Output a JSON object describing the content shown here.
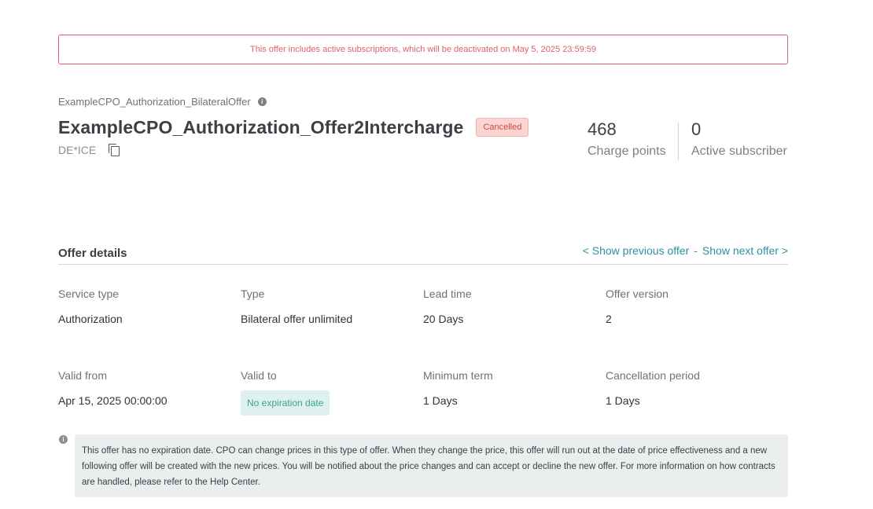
{
  "alert": {
    "message": "This offer includes active subscriptions, which will be deactivated on May 5, 2025 23:59:59"
  },
  "header": {
    "parent_offer": "ExampleCPO_Authorization_BilateralOffer",
    "title": "ExampleCPO_Authorization_Offer2Intercharge",
    "status": "Cancelled",
    "code": "DE*ICE"
  },
  "stats": [
    {
      "value": "468",
      "label": "Charge points"
    },
    {
      "value": "0",
      "label": "Active subscriber"
    }
  ],
  "details": {
    "section_title": "Offer details",
    "prev_link": "< Show previous offer",
    "separator": "-",
    "next_link": "Show next offer >",
    "fields": {
      "service_type": {
        "label": "Service type",
        "value": "Authorization"
      },
      "type": {
        "label": "Type",
        "value": "Bilateral offer unlimited"
      },
      "lead_time": {
        "label": "Lead time",
        "value": "20 Days"
      },
      "offer_version": {
        "label": "Offer version",
        "value": "2"
      },
      "valid_from": {
        "label": "Valid from",
        "value": "Apr 15, 2025 00:00:00"
      },
      "valid_to": {
        "label": "Valid to",
        "value": "No expiration date"
      },
      "minimum_term": {
        "label": "Minimum term",
        "value": "1 Days"
      },
      "cancellation_period": {
        "label": "Cancellation period",
        "value": "1 Days"
      }
    }
  },
  "note": {
    "text": "This offer has no expiration date. CPO can change prices in this type of offer. When they change the price, this offer will run out at the date of price effectiveness and a new following offer will be created with the new prices. You will be notified about the price changes and can accept or decline the new offer. For more information on how contracts are handled, please refer to the Help Center."
  },
  "icons": {
    "info": "info-icon",
    "copy": "copy-icon"
  },
  "colors": {
    "alert": "#e0606a",
    "link": "#2f8fa3",
    "badge_bg": "#fbd5d2",
    "chip_bg": "#dff1ee"
  }
}
